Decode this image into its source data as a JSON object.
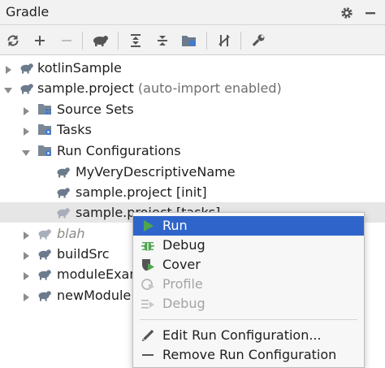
{
  "panel": {
    "title": "Gradle"
  },
  "tree": {
    "rows": [
      {
        "label": "kotlinSample",
        "hint": ""
      },
      {
        "label": "sample.project",
        "hint": "(auto-import enabled)"
      },
      {
        "label": "Source Sets"
      },
      {
        "label": "Tasks"
      },
      {
        "label": "Run Configurations"
      },
      {
        "label": "MyVeryDescriptiveName"
      },
      {
        "label": "sample.project [init]"
      },
      {
        "label": "sample.project [tasks]"
      },
      {
        "label": "blah"
      },
      {
        "label": "buildSrc"
      },
      {
        "label": "moduleExample"
      },
      {
        "label": "newModule"
      }
    ]
  },
  "context_menu": {
    "items": [
      {
        "label": "Run",
        "icon": "run-icon"
      },
      {
        "label": "Debug",
        "icon": "bug-icon"
      },
      {
        "label": "Cover",
        "icon": "coverage-icon"
      },
      {
        "label": "Profile",
        "icon": "profile-icon"
      },
      {
        "label": "Debug",
        "icon": "debug-list-icon"
      },
      {
        "label": "Edit Run Configuration...",
        "icon": "pencil-icon"
      },
      {
        "label": "Remove Run Configuration",
        "icon": "minus-icon"
      }
    ]
  },
  "colors": {
    "accent": "#2f65ca",
    "run_green": "#4fa64f",
    "elephant": "#6b7b8c"
  }
}
